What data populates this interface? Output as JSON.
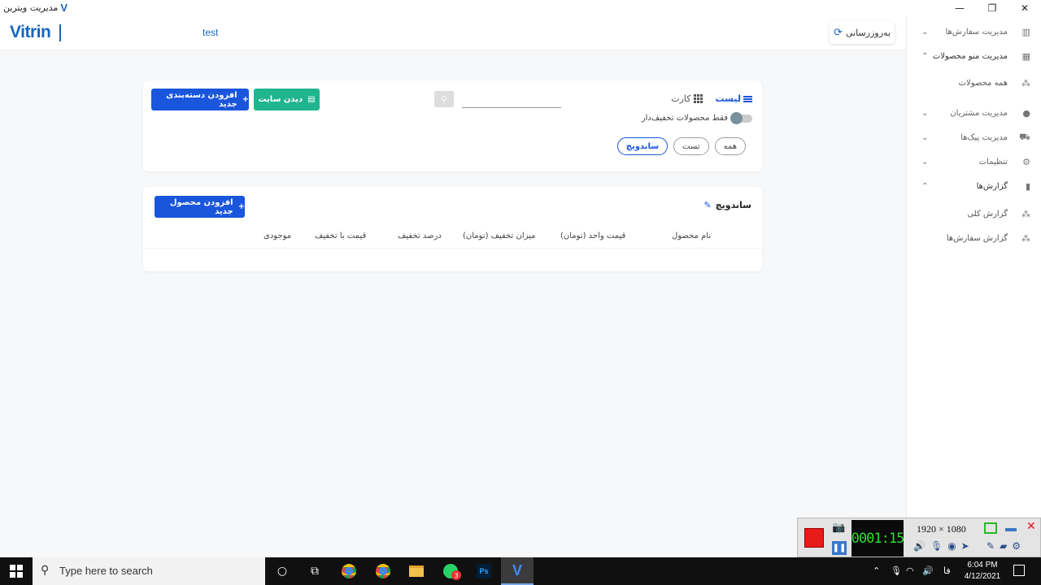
{
  "window": {
    "title": "مدیریت ویترین",
    "logo_letter": "V",
    "controls": {
      "minimize": "—",
      "maximize": "❐",
      "close": "✕"
    }
  },
  "header": {
    "brand": "Vitrin",
    "store_name": "test",
    "refresh_label": "به‌روزرسانی"
  },
  "toolbar": {
    "add_category_label": "افزودن دسته‌بندی جدید",
    "view_site_label": "دیدن سایت",
    "search_placeholder": "",
    "view_list_label": "لیست",
    "view_card_label": "کارت",
    "discount_only_label": "فقط محصولات تخفیف‌دار",
    "discount_only_enabled": false,
    "chips": [
      {
        "label": "همه",
        "active": false
      },
      {
        "label": "تست",
        "active": false
      },
      {
        "label": "ساندویچ",
        "active": true
      }
    ]
  },
  "category_section": {
    "title": "ساندویچ",
    "add_product_label": "افزودن محصول جدید",
    "columns": [
      "نام محصول",
      "قیمت واحد (تومان)",
      "میزان تخفیف (تومان)",
      "درصد تخفیف",
      "قیمت با تخفیف",
      "موجودی"
    ]
  },
  "sidebar": {
    "items": [
      {
        "label": "مدیریت سفارش‌ها",
        "icon": "orders-icon",
        "chevron": "down"
      },
      {
        "label": "مدیریت منو محصولات",
        "icon": "grid-icon",
        "chevron": "up",
        "open": true
      },
      {
        "label": "همه محصولات",
        "icon": "shapes-icon",
        "sub": true
      },
      {
        "label": "مدیریت مشتریان",
        "icon": "person-icon",
        "chevron": "down"
      },
      {
        "label": "مدیریت پیک‌ها",
        "icon": "courier-icon",
        "chevron": "down"
      },
      {
        "label": "تنظیمات",
        "icon": "gear-icon",
        "chevron": "down"
      },
      {
        "label": "گزارش‌ها",
        "icon": "bar-chart-icon",
        "chevron": "up",
        "open": true
      },
      {
        "label": "گزارش کلی",
        "icon": "shapes-icon",
        "sub": true
      },
      {
        "label": "گزارش سفارش‌ها",
        "icon": "shapes-icon",
        "sub": true
      }
    ]
  },
  "recorder": {
    "timer": "0001:15",
    "resolution": "1920 × 1080"
  },
  "taskbar": {
    "search_placeholder": "Type here to search",
    "whatsapp_badge": "3",
    "photoshop_label": "Ps",
    "language": "فا",
    "time": "6:04 PM",
    "date": "4/12/2021"
  }
}
